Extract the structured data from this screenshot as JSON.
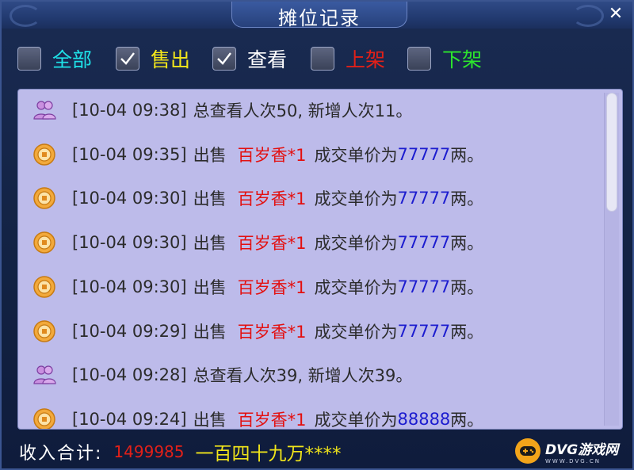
{
  "window": {
    "title": "摊位记录",
    "close_glyph": "✕"
  },
  "filters": [
    {
      "label": "全部",
      "checked": false,
      "color": "#1ee2e8"
    },
    {
      "label": "售出",
      "checked": true,
      "color": "#f2e61a"
    },
    {
      "label": "查看",
      "checked": true,
      "color": "#ffffff"
    },
    {
      "label": "上架",
      "checked": false,
      "color": "#e32018"
    },
    {
      "label": "下架",
      "checked": false,
      "color": "#2de52d"
    }
  ],
  "records": [
    {
      "type": "view",
      "icon": "visitors-icon",
      "time": "[10-04 09:38]",
      "text": "总查看人次50, 新增人次11。"
    },
    {
      "type": "sale",
      "icon": "coin-icon",
      "time": "[10-04 09:35]",
      "action": "出售",
      "item": "百岁香*1",
      "price_prefix": "成交单价为",
      "price": "77777",
      "price_suffix": "两。"
    },
    {
      "type": "sale",
      "icon": "coin-icon",
      "time": "[10-04 09:30]",
      "action": "出售",
      "item": "百岁香*1",
      "price_prefix": "成交单价为",
      "price": "77777",
      "price_suffix": "两。"
    },
    {
      "type": "sale",
      "icon": "coin-icon",
      "time": "[10-04 09:30]",
      "action": "出售",
      "item": "百岁香*1",
      "price_prefix": "成交单价为",
      "price": "77777",
      "price_suffix": "两。"
    },
    {
      "type": "sale",
      "icon": "coin-icon",
      "time": "[10-04 09:30]",
      "action": "出售",
      "item": "百岁香*1",
      "price_prefix": "成交单价为",
      "price": "77777",
      "price_suffix": "两。"
    },
    {
      "type": "sale",
      "icon": "coin-icon",
      "time": "[10-04 09:29]",
      "action": "出售",
      "item": "百岁香*1",
      "price_prefix": "成交单价为",
      "price": "77777",
      "price_suffix": "两。"
    },
    {
      "type": "view",
      "icon": "visitors-icon",
      "time": "[10-04 09:28]",
      "text": "总查看人次39, 新增人次39。"
    },
    {
      "type": "sale",
      "icon": "coin-icon",
      "time": "[10-04 09:24]",
      "action": "出售",
      "item": "百岁香*1",
      "price_prefix": "成交单价为",
      "price": "88888",
      "price_suffix": "两。"
    }
  ],
  "footer": {
    "label": "收入合计:",
    "amount": "1499985",
    "amount_words": "一百四十九万****"
  },
  "watermark": {
    "name": "DVG游戏网",
    "domain": "WWW.DVG.CN"
  },
  "colors": {
    "sale_item": "#e31010",
    "price": "#1c1ccf",
    "footer_label": "#ffffff",
    "footer_amount": "#e32018",
    "footer_words": "#f2e61a"
  }
}
